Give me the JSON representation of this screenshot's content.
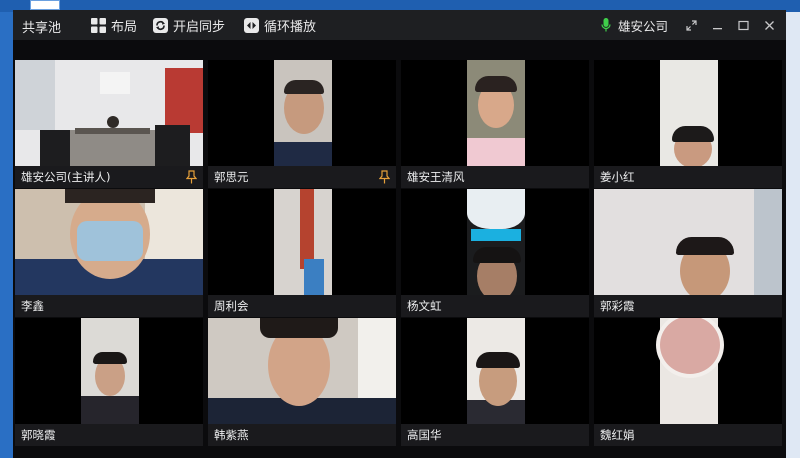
{
  "window": {
    "title": "共享池",
    "toolbar": [
      {
        "label": "布局",
        "icon": "grid-layout-icon"
      },
      {
        "label": "开启同步",
        "icon": "sync-icon"
      },
      {
        "label": "循环播放",
        "icon": "loop-play-icon"
      }
    ],
    "speaker": "雄安公司",
    "controls": [
      "fullscreen-icon",
      "minimize-icon",
      "maximize-icon",
      "close-icon"
    ]
  },
  "participants": [
    {
      "name": "雄安公司(主讲人)",
      "pinned": true
    },
    {
      "name": "郭思元",
      "pinned": true
    },
    {
      "name": "雄安王清风",
      "pinned": false
    },
    {
      "name": "姜小红",
      "pinned": false
    },
    {
      "name": "李鑫",
      "pinned": false
    },
    {
      "name": "周利会",
      "pinned": false
    },
    {
      "name": "杨文虹",
      "pinned": false
    },
    {
      "name": "郭彩霞",
      "pinned": false
    },
    {
      "name": "郭晓霞",
      "pinned": false
    },
    {
      "name": "韩紫燕",
      "pinned": false
    },
    {
      "name": "高国华",
      "pinned": false
    },
    {
      "name": "魏红娟",
      "pinned": false
    }
  ],
  "colors": {
    "titlebar": "#1e1f22",
    "caption": "#1a1a1d",
    "pin": "#e6a03a",
    "mic": "#3fcf4a"
  }
}
